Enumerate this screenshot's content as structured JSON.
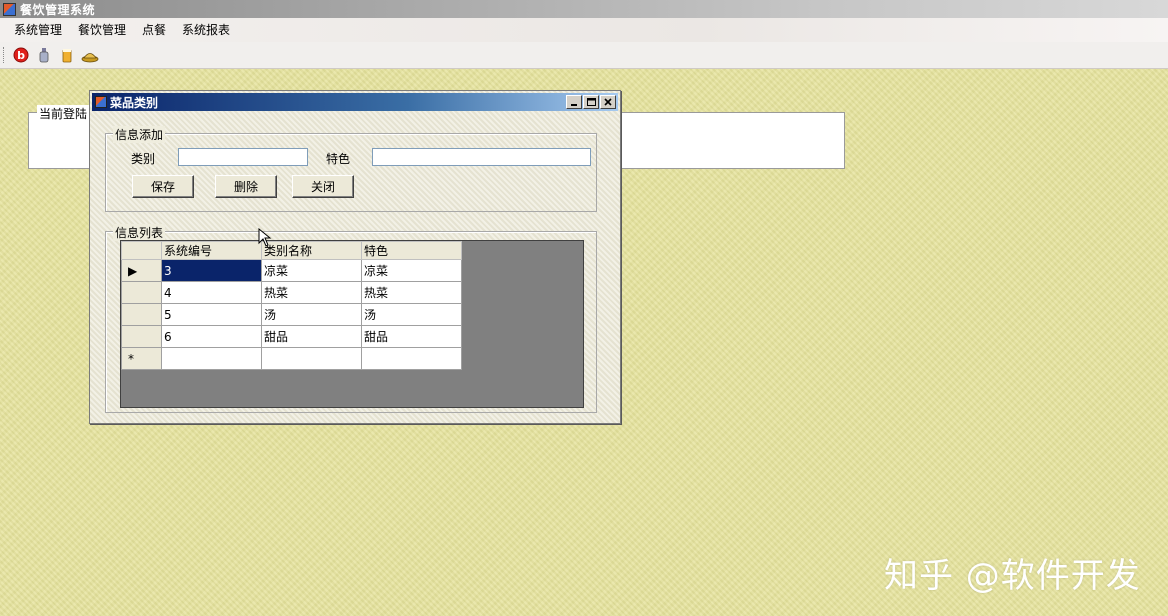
{
  "app": {
    "title": "餐饮管理系统",
    "menu": [
      "系统管理",
      "餐饮管理",
      "点餐",
      "系统报表"
    ],
    "toolbar_icons": [
      "baidu-b-icon",
      "bottle-icon",
      "beer-icon",
      "food-plate-icon"
    ],
    "main_panel_label": "当前登陆"
  },
  "dialog": {
    "title": "菜品类别",
    "add_group": {
      "legend": "信息添加",
      "category_label": "类别",
      "category_value": "",
      "feature_label": "特色",
      "feature_value": "",
      "save_label": "保存",
      "delete_label": "删除",
      "close_label": "关闭"
    },
    "list_group": {
      "legend": "信息列表",
      "columns": [
        "系统编号",
        "类别名称",
        "特色"
      ],
      "rows": [
        [
          "3",
          "凉菜",
          "凉菜"
        ],
        [
          "4",
          "热菜",
          "热菜"
        ],
        [
          "5",
          "汤",
          "汤"
        ],
        [
          "6",
          "甜品",
          "甜品"
        ]
      ],
      "current_marker": "▶",
      "new_row_marker": "*"
    }
  },
  "watermark": "知乎 @软件开发",
  "colors": {
    "desktop": "#e6e39c",
    "titlebar_active": "#0a246a",
    "selection": "#0a246a",
    "grid_bg": "#808080"
  }
}
